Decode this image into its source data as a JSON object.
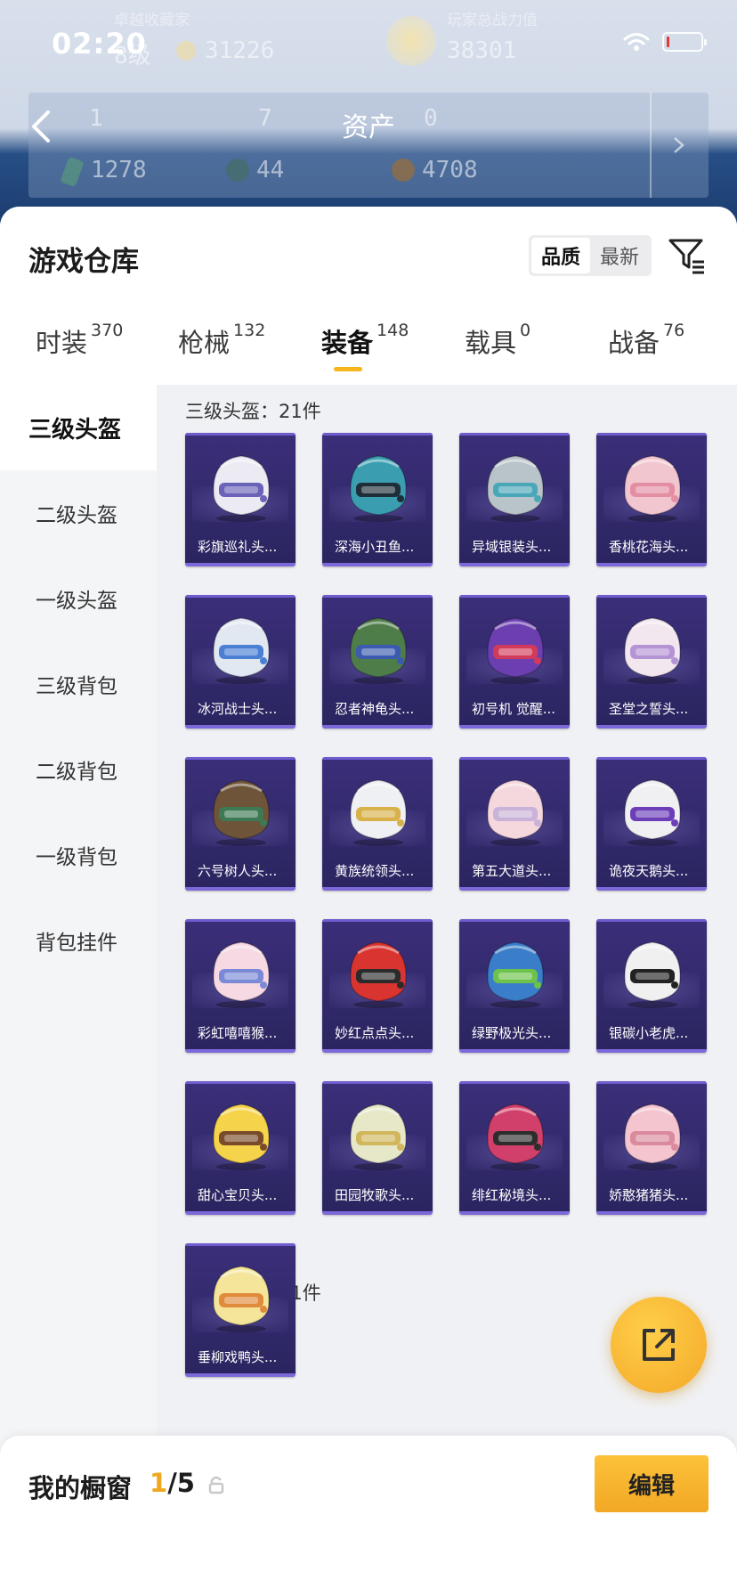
{
  "status_bar": {
    "time": "02:20"
  },
  "header": {
    "title": "资产",
    "faint_stats": {
      "label_left": "卓越收藏家",
      "label_right": "玩家总战力值",
      "level": "8级",
      "coins": "31226",
      "power": "38301",
      "row2": [
        "1",
        "7",
        "0"
      ],
      "row3": [
        "1278",
        "44",
        "4708"
      ]
    }
  },
  "warehouse": {
    "title": "游戏仓库",
    "sort_options": [
      "品质",
      "最新"
    ],
    "sort_selected": "品质"
  },
  "tabs": [
    {
      "label": "时装",
      "count": "370"
    },
    {
      "label": "枪械",
      "count": "132"
    },
    {
      "label": "装备",
      "count": "148",
      "active": true
    },
    {
      "label": "载具",
      "count": "0"
    },
    {
      "label": "战备",
      "count": "76"
    }
  ],
  "sidebar": [
    {
      "label": "三级头盔",
      "active": true
    },
    {
      "label": "二级头盔"
    },
    {
      "label": "一级头盔"
    },
    {
      "label": "三级背包"
    },
    {
      "label": "二级背包"
    },
    {
      "label": "一级背包"
    },
    {
      "label": "背包挂件"
    }
  ],
  "sections": [
    {
      "title": "三级头盔：21件"
    },
    {
      "title": "二级头盔：11件"
    }
  ],
  "items": [
    {
      "name": "彩旗巡礼头...",
      "color": "#ecebf3",
      "accent": "#6b63b8"
    },
    {
      "name": "深海小丑鱼...",
      "color": "#3a9eb0",
      "accent": "#1e2f3a"
    },
    {
      "name": "异域银装头...",
      "color": "#b9c3ca",
      "accent": "#4aa7b8"
    },
    {
      "name": "香桃花海头...",
      "color": "#f2c6cf",
      "accent": "#e38ea3"
    },
    {
      "name": "冰河战士头...",
      "color": "#e2e8f2",
      "accent": "#4a7fd4"
    },
    {
      "name": "忍者神龟头...",
      "color": "#4f7d4a",
      "accent": "#3a5bb0"
    },
    {
      "name": "初号机 觉醒...",
      "color": "#6b3fb0",
      "accent": "#d13a5a"
    },
    {
      "name": "圣堂之誓头...",
      "color": "#f3e7ef",
      "accent": "#b594d6"
    },
    {
      "name": "六号树人头...",
      "color": "#6e5438",
      "accent": "#3d7a53"
    },
    {
      "name": "黄族统领头...",
      "color": "#eef0f3",
      "accent": "#d9b14a"
    },
    {
      "name": "第五大道头...",
      "color": "#f5d7de",
      "accent": "#c9b3d8"
    },
    {
      "name": "诡夜天鹅头...",
      "color": "#f0f0f3",
      "accent": "#6c3fb8"
    },
    {
      "name": "彩虹嘻嘻猴...",
      "color": "#f6d9e2",
      "accent": "#7a8ad6"
    },
    {
      "name": "妙红点点头...",
      "color": "#d9342f",
      "accent": "#2b2b2b"
    },
    {
      "name": "绿野极光头...",
      "color": "#3a7dc9",
      "accent": "#6cc24a"
    },
    {
      "name": "银碳小老虎...",
      "color": "#f0f0f0",
      "accent": "#222222"
    },
    {
      "name": "甜心宝贝头...",
      "color": "#f5d34a",
      "accent": "#7a4b2a"
    },
    {
      "name": "田园牧歌头...",
      "color": "#e6e8c8",
      "accent": "#d1b75c"
    },
    {
      "name": "绯红秘境头...",
      "color": "#d1406a",
      "accent": "#2d2d2d"
    },
    {
      "name": "娇憨猪猪头...",
      "color": "#f4c4cf",
      "accent": "#d98a9c"
    },
    {
      "name": "垂柳戏鸭头...",
      "color": "#f4e59a",
      "accent": "#e08a3c"
    }
  ],
  "window": {
    "label": "我的橱窗",
    "current": "1",
    "total": "/5"
  },
  "edit_label": "编辑"
}
